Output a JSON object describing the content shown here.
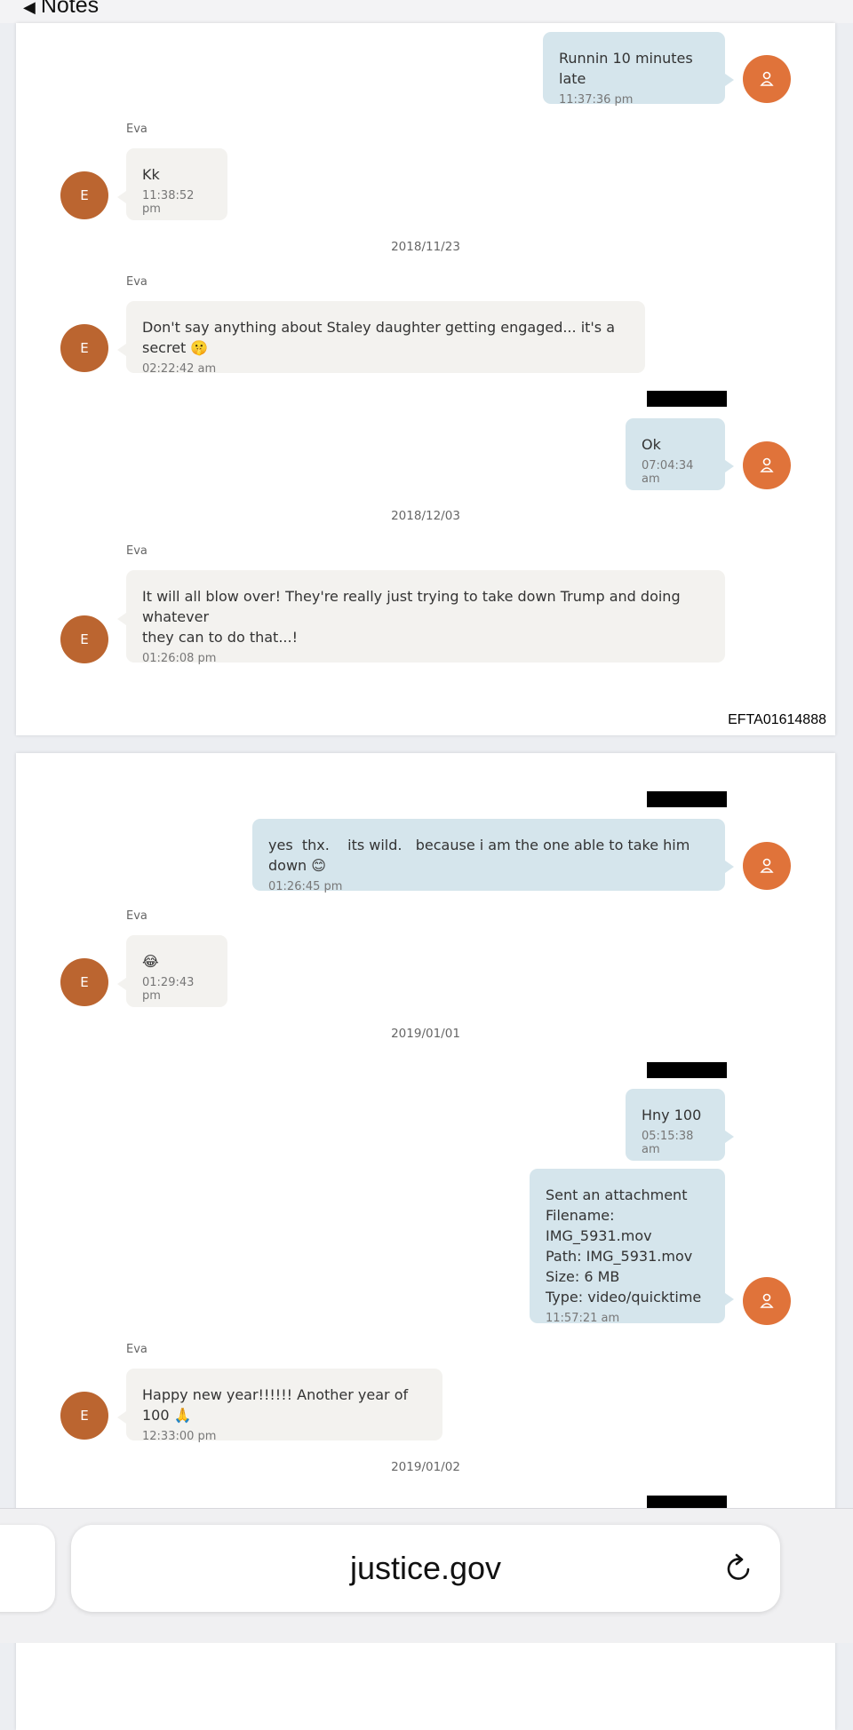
{
  "nav": {
    "back_label": "Notes"
  },
  "page1": {
    "messages": [
      {
        "text": "Runnin 10 minutes late",
        "time": "11:37:36 pm"
      },
      {
        "sender": "Eva",
        "avatar": "E",
        "text": "Kk",
        "time": "11:38:52 pm"
      },
      {
        "date": "2018/11/23"
      },
      {
        "sender": "Eva",
        "avatar": "E",
        "text": "Don't say anything about Staley daughter getting engaged... it's a secret 🤫",
        "time": "02:22:42 am"
      },
      {
        "text": "Ok",
        "time": "07:04:34 am"
      },
      {
        "date": "2018/12/03"
      },
      {
        "sender": "Eva",
        "avatar": "E",
        "text": "It will all blow over! They're really just trying to take down Trump and doing whatever\nthey can to do that...!",
        "time": "01:26:08 pm"
      }
    ],
    "doc_id": "EFTA01614888"
  },
  "page2": {
    "messages": [
      {
        "text": "yes  thx.    its wild.   because i am the one able to take him down 😊",
        "time": "01:26:45 pm"
      },
      {
        "sender": "Eva",
        "avatar": "E",
        "text": "😂",
        "time": "01:29:43 pm"
      },
      {
        "date": "2019/01/01"
      },
      {
        "text": "Hny 100",
        "time": "05:15:38 am"
      },
      {
        "text": "Sent an attachment\nFilename: IMG_5931.mov\nPath: IMG_5931.mov\nSize: 6 MB\nType: video/quicktime",
        "time": "11:57:21 am"
      },
      {
        "sender": "Eva",
        "avatar": "E",
        "text": "Happy new year!!!!!! Another year of 100 🙏",
        "time": "12:33:00 pm"
      },
      {
        "date": "2019/01/02"
      }
    ]
  },
  "browser": {
    "url": "justice.gov"
  },
  "colors": {
    "outgoing_bubble": "#d5e5ec",
    "incoming_bubble": "#f3f2ef",
    "me_avatar": "#e0733a",
    "eva_avatar": "#bb6530"
  },
  "icons": {
    "me_avatar": "user-icon",
    "reload": "reload-icon",
    "back": "back-triangle-icon"
  }
}
